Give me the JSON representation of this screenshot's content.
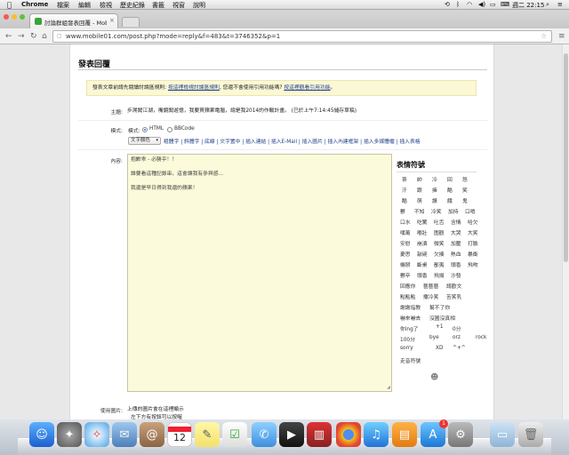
{
  "menubar": {
    "app": "Chrome",
    "items": [
      "檔案",
      "編輯",
      "檢視",
      "歷史紀錄",
      "書籤",
      "視窗",
      "說明"
    ],
    "clock": "週二 22:15"
  },
  "browser": {
    "tab_title": "討論群組發表回覆 - Mobile",
    "url": "www.mobile01.com/post.php?mode=reply&f=483&t=3746352&p=1"
  },
  "page": {
    "heading": "發表回覆",
    "notice": {
      "pre": "發表文章前請先閱讀討論區規則: ",
      "link1": "按這裡檢視討論區規則",
      "mid": ", 您還不會使用引用功能嗎? ",
      "link2": "按這裡觀看引用功能",
      "post": "。"
    },
    "subject": {
      "label": "主題:",
      "value": "步溯闖江湖，嘴鏡闖遊憶，我要買蘋果電腦，總是我2014的作戰計畫。 (已於上午7:14:45儲存草稿)"
    },
    "mode": {
      "label": "模式:",
      "prefix": "模式:",
      "html": "HTML",
      "bbcode": "BBCode",
      "font_color_select": "文字顏色",
      "toolbar_links": "粗體字 | 斜體字 | 底線 | 文字置中 | 插入連結 | 插入E-Mail | 插入圖片 | 插入內建框架 | 插入多媒體檔 | 插入表格"
    },
    "content": {
      "label": "內容:",
      "lines": [
        "抱歉乖 - 必勝乎！！",
        "誰要看這種記錄串，這會讓我有參與感...",
        "我還是早日得到我還的蘋果！"
      ]
    },
    "emoticons": {
      "title": "表情符號",
      "rows": [
        [
          "茶",
          "帥",
          "冷",
          "回",
          "怒"
        ],
        [
          "汗",
          "跟",
          "擁",
          "酷",
          "笑"
        ],
        [
          "酷",
          "萌",
          "讚",
          "餓",
          "鬼"
        ],
        [
          "鬱",
          "不知",
          "冷笑",
          "加持",
          "口哨"
        ],
        [
          "口水",
          "吃驚",
          "吐舌",
          "含情",
          "哈欠"
        ],
        [
          "噗萬",
          "嘟壯",
          "圍觀",
          "大哭",
          "大笑"
        ],
        [
          "安慰",
          "崩潰",
          "微笑",
          "加壓",
          "打臉"
        ],
        [
          "憂思",
          "敲碗",
          "欠揍",
          "熱血",
          "暴衝"
        ],
        [
          "機掰",
          "斷桌",
          "鄙夷",
          "頭香",
          "飛吻"
        ],
        [
          "鬱卒",
          "頭香",
          "飛揚",
          "沙發"
        ],
        [
          "回應你",
          "藝藝藝",
          "請歡文"
        ],
        [
          "點點點",
          "撒冷笑",
          "苦笑乳"
        ],
        [
          "謝謝指教",
          "幫不了你"
        ],
        [
          "嚇來嚇去",
          "沒圖沒真相"
        ],
        [
          "你ing了",
          "+1",
          "0分"
        ],
        [
          "100分",
          "bye",
          "orz",
          "rock"
        ],
        [
          "sorry",
          "XD",
          "^+^"
        ],
        [
          "走音符號"
        ]
      ]
    },
    "bottom": {
      "label": "使用圖片:",
      "text1": "上傳的圖片會在這裡顯示",
      "text2": "左下方有按鈕可以按喔"
    }
  },
  "dock": {
    "calendar_day": "12",
    "appstore_badge": "1"
  },
  "colors": {
    "editor_bg": "#fbfbdb",
    "notice_bg": "#fbf8d6",
    "link": "#1d3f8a"
  }
}
